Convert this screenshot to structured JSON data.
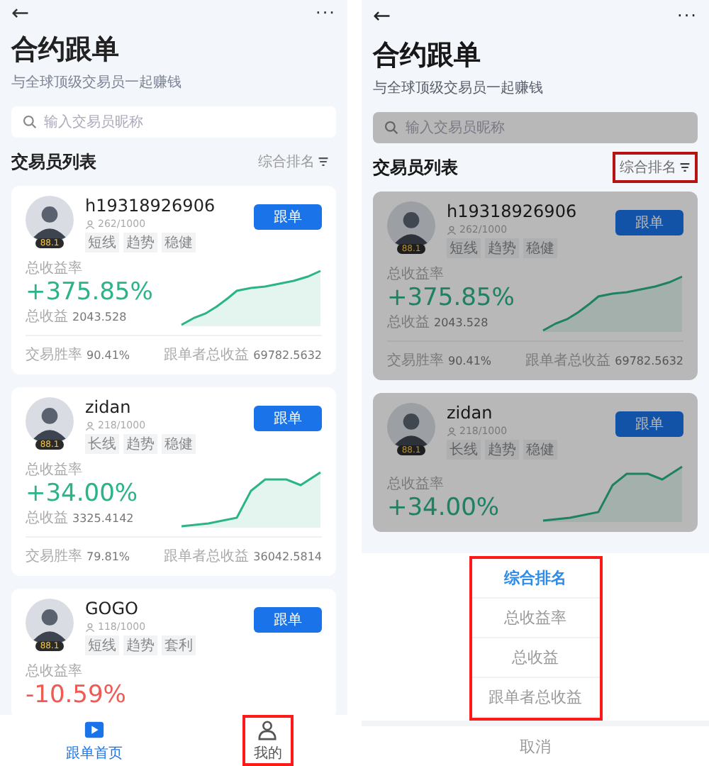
{
  "screens": [
    {
      "dimmed": false,
      "back": "←",
      "more": "···",
      "title": "合约跟单",
      "subtitle": "与全球顶级交易员一起赚钱",
      "search": {
        "placeholder": "输入交易员昵称"
      },
      "list_title": "交易员列表",
      "sort": {
        "label": "综合排名",
        "highlighted": false
      },
      "traders": [
        {
          "name": "h19318926906",
          "badge": "88.1",
          "followers": "262/1000",
          "tags": [
            "短线",
            "趋势",
            "稳健"
          ],
          "follow": "跟单",
          "rate_label": "总收益率",
          "rate": "+375.85%",
          "loss": false,
          "income_label": "总收益",
          "income": "2043.528",
          "win_label": "交易胜率",
          "win": "90.41%",
          "copier_label": "跟单者总收益",
          "copier": "69782.5632"
        },
        {
          "name": "zidan",
          "badge": "88.1",
          "followers": "218/1000",
          "tags": [
            "长线",
            "趋势",
            "稳健"
          ],
          "follow": "跟单",
          "rate_label": "总收益率",
          "rate": "+34.00%",
          "loss": false,
          "income_label": "总收益",
          "income": "3325.4142",
          "win_label": "交易胜率",
          "win": "79.81%",
          "copier_label": "跟单者总收益",
          "copier": "36042.5814"
        },
        {
          "name": "GOGO",
          "badge": "88.1",
          "followers": "118/1000",
          "tags": [
            "短线",
            "趋势",
            "套利"
          ],
          "follow": "跟单",
          "rate_label": "总收益率",
          "rate": "-10.59%",
          "loss": true
        }
      ],
      "nav": [
        {
          "label": "跟单首页",
          "kind": "home",
          "selected": true,
          "highlighted": false
        },
        {
          "label": "我的",
          "kind": "profile",
          "selected": false,
          "highlighted": true
        }
      ]
    },
    {
      "dimmed": true,
      "back": "←",
      "more": "···",
      "title": "合约跟单",
      "subtitle": "与全球顶级交易员一起赚钱",
      "search": {
        "placeholder": "输入交易员昵称"
      },
      "list_title": "交易员列表",
      "sort": {
        "label": "综合排名",
        "highlighted": true
      },
      "traders": [
        {
          "name": "h19318926906",
          "badge": "88.1",
          "followers": "262/1000",
          "tags": [
            "短线",
            "趋势",
            "稳健"
          ],
          "follow": "跟单",
          "rate_label": "总收益率",
          "rate": "+375.85%",
          "loss": false,
          "income_label": "总收益",
          "income": "2043.528",
          "win_label": "交易胜率",
          "win": "90.41%",
          "copier_label": "跟单者总收益",
          "copier": "69782.5632"
        },
        {
          "name": "zidan",
          "badge": "88.1",
          "followers": "218/1000",
          "tags": [
            "长线",
            "趋势",
            "稳健"
          ],
          "follow": "跟单",
          "rate_label": "总收益率",
          "rate": "+34.00%",
          "loss": false
        }
      ],
      "sheet": {
        "highlighted": true,
        "options": [
          {
            "label": "综合排名",
            "selected": true
          },
          {
            "label": "总收益率",
            "selected": false
          },
          {
            "label": "总收益",
            "selected": false
          },
          {
            "label": "跟单者总收益",
            "selected": false
          }
        ],
        "cancel": "取消"
      }
    }
  ]
}
